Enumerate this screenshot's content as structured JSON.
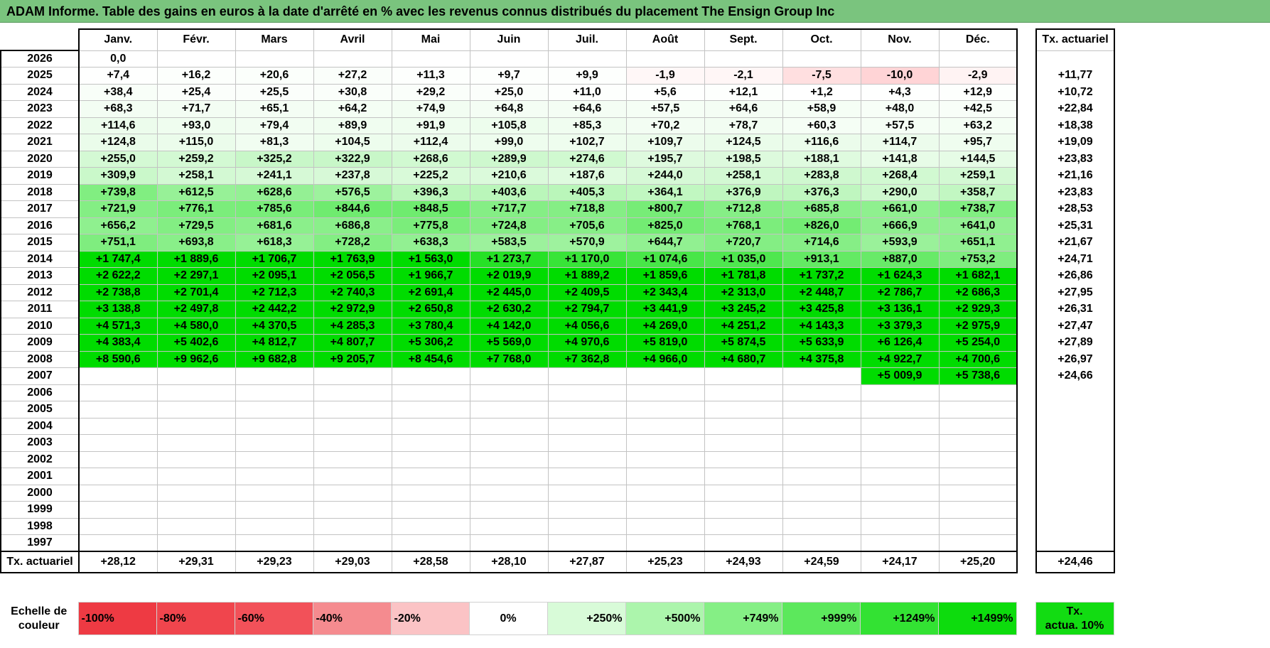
{
  "title": "ADAM Informe. Table des gains en euros à la date d'arrêté en % avec les revenus connus distribués du placement The Ensign Group Inc",
  "months": [
    "Janv.",
    "Févr.",
    "Mars",
    "Avril",
    "Mai",
    "Juin",
    "Juil.",
    "Août",
    "Sept.",
    "Oct.",
    "Nov.",
    "Déc."
  ],
  "actuarial_header": "Tx. actuariel",
  "rows": [
    {
      "year": "2026",
      "values": [
        "0,0",
        "",
        "",
        "",
        "",
        "",
        "",
        "",
        "",
        "",
        "",
        ""
      ],
      "rate": ""
    },
    {
      "year": "2025",
      "values": [
        "+7,4",
        "+16,2",
        "+20,6",
        "+27,2",
        "+11,3",
        "+9,7",
        "+9,9",
        "-1,9",
        "-2,1",
        "-7,5",
        "-10,0",
        "-2,9"
      ],
      "rate": "+11,77"
    },
    {
      "year": "2024",
      "values": [
        "+38,4",
        "+25,4",
        "+25,5",
        "+30,8",
        "+29,2",
        "+25,0",
        "+11,0",
        "+5,6",
        "+12,1",
        "+1,2",
        "+4,3",
        "+12,9"
      ],
      "rate": "+10,72"
    },
    {
      "year": "2023",
      "values": [
        "+68,3",
        "+71,7",
        "+65,1",
        "+64,2",
        "+74,9",
        "+64,8",
        "+64,6",
        "+57,5",
        "+64,6",
        "+58,9",
        "+48,0",
        "+42,5"
      ],
      "rate": "+22,84"
    },
    {
      "year": "2022",
      "values": [
        "+114,6",
        "+93,0",
        "+79,4",
        "+89,9",
        "+91,9",
        "+105,8",
        "+85,3",
        "+70,2",
        "+78,7",
        "+60,3",
        "+57,5",
        "+63,2"
      ],
      "rate": "+18,38"
    },
    {
      "year": "2021",
      "values": [
        "+124,8",
        "+115,0",
        "+81,3",
        "+104,5",
        "+112,4",
        "+99,0",
        "+102,7",
        "+109,7",
        "+124,5",
        "+116,6",
        "+114,7",
        "+95,7"
      ],
      "rate": "+19,09"
    },
    {
      "year": "2020",
      "values": [
        "+255,0",
        "+259,2",
        "+325,2",
        "+322,9",
        "+268,6",
        "+289,9",
        "+274,6",
        "+195,7",
        "+198,5",
        "+188,1",
        "+141,8",
        "+144,5"
      ],
      "rate": "+23,83"
    },
    {
      "year": "2019",
      "values": [
        "+309,9",
        "+258,1",
        "+241,1",
        "+237,8",
        "+225,2",
        "+210,6",
        "+187,6",
        "+244,0",
        "+258,1",
        "+283,8",
        "+268,4",
        "+259,1"
      ],
      "rate": "+21,16"
    },
    {
      "year": "2018",
      "values": [
        "+739,8",
        "+612,5",
        "+628,6",
        "+576,5",
        "+396,3",
        "+403,6",
        "+405,3",
        "+364,1",
        "+376,9",
        "+376,3",
        "+290,0",
        "+358,7"
      ],
      "rate": "+23,83"
    },
    {
      "year": "2017",
      "values": [
        "+721,9",
        "+776,1",
        "+785,6",
        "+844,6",
        "+848,5",
        "+717,7",
        "+718,8",
        "+800,7",
        "+712,8",
        "+685,8",
        "+661,0",
        "+738,7"
      ],
      "rate": "+28,53"
    },
    {
      "year": "2016",
      "values": [
        "+656,2",
        "+729,5",
        "+681,6",
        "+686,8",
        "+775,8",
        "+724,8",
        "+705,6",
        "+825,0",
        "+768,1",
        "+826,0",
        "+666,9",
        "+641,0"
      ],
      "rate": "+25,31"
    },
    {
      "year": "2015",
      "values": [
        "+751,1",
        "+693,8",
        "+618,3",
        "+728,2",
        "+638,3",
        "+583,5",
        "+570,9",
        "+644,7",
        "+720,7",
        "+714,6",
        "+593,9",
        "+651,1"
      ],
      "rate": "+21,67"
    },
    {
      "year": "2014",
      "values": [
        "+1 747,4",
        "+1 889,6",
        "+1 706,7",
        "+1 763,9",
        "+1 563,0",
        "+1 273,7",
        "+1 170,0",
        "+1 074,6",
        "+1 035,0",
        "+913,1",
        "+887,0",
        "+753,2"
      ],
      "rate": "+24,71"
    },
    {
      "year": "2013",
      "values": [
        "+2 622,2",
        "+2 297,1",
        "+2 095,1",
        "+2 056,5",
        "+1 966,7",
        "+2 019,9",
        "+1 889,2",
        "+1 859,6",
        "+1 781,8",
        "+1 737,2",
        "+1 624,3",
        "+1 682,1"
      ],
      "rate": "+26,86"
    },
    {
      "year": "2012",
      "values": [
        "+2 738,8",
        "+2 701,4",
        "+2 712,3",
        "+2 740,3",
        "+2 691,4",
        "+2 445,0",
        "+2 409,5",
        "+2 343,4",
        "+2 313,0",
        "+2 448,7",
        "+2 786,7",
        "+2 686,3"
      ],
      "rate": "+27,95"
    },
    {
      "year": "2011",
      "values": [
        "+3 138,8",
        "+2 497,8",
        "+2 442,2",
        "+2 972,9",
        "+2 650,8",
        "+2 630,2",
        "+2 794,7",
        "+3 441,9",
        "+3 245,2",
        "+3 425,8",
        "+3 136,1",
        "+2 929,3"
      ],
      "rate": "+26,31"
    },
    {
      "year": "2010",
      "values": [
        "+4 571,3",
        "+4 580,0",
        "+4 370,5",
        "+4 285,3",
        "+3 780,4",
        "+4 142,0",
        "+4 056,6",
        "+4 269,0",
        "+4 251,2",
        "+4 143,3",
        "+3 379,3",
        "+2 975,9"
      ],
      "rate": "+27,47"
    },
    {
      "year": "2009",
      "values": [
        "+4 383,4",
        "+5 402,6",
        "+4 812,7",
        "+4 807,7",
        "+5 306,2",
        "+5 569,0",
        "+4 970,6",
        "+5 819,0",
        "+5 874,5",
        "+5 633,9",
        "+6 126,4",
        "+5 254,0"
      ],
      "rate": "+27,89"
    },
    {
      "year": "2008",
      "values": [
        "+8 590,6",
        "+9 962,6",
        "+9 682,8",
        "+9 205,7",
        "+8 454,6",
        "+7 768,0",
        "+7 362,8",
        "+4 966,0",
        "+4 680,7",
        "+4 375,8",
        "+4 922,7",
        "+4 700,6"
      ],
      "rate": "+26,97"
    },
    {
      "year": "2007",
      "values": [
        "",
        "",
        "",
        "",
        "",
        "",
        "",
        "",
        "",
        "",
        "+5 009,9",
        "+5 738,6"
      ],
      "rate": "+24,66"
    },
    {
      "year": "2006",
      "values": [
        "",
        "",
        "",
        "",
        "",
        "",
        "",
        "",
        "",
        "",
        "",
        ""
      ],
      "rate": ""
    },
    {
      "year": "2005",
      "values": [
        "",
        "",
        "",
        "",
        "",
        "",
        "",
        "",
        "",
        "",
        "",
        ""
      ],
      "rate": ""
    },
    {
      "year": "2004",
      "values": [
        "",
        "",
        "",
        "",
        "",
        "",
        "",
        "",
        "",
        "",
        "",
        ""
      ],
      "rate": ""
    },
    {
      "year": "2003",
      "values": [
        "",
        "",
        "",
        "",
        "",
        "",
        "",
        "",
        "",
        "",
        "",
        ""
      ],
      "rate": ""
    },
    {
      "year": "2002",
      "values": [
        "",
        "",
        "",
        "",
        "",
        "",
        "",
        "",
        "",
        "",
        "",
        ""
      ],
      "rate": ""
    },
    {
      "year": "2001",
      "values": [
        "",
        "",
        "",
        "",
        "",
        "",
        "",
        "",
        "",
        "",
        "",
        ""
      ],
      "rate": ""
    },
    {
      "year": "2000",
      "values": [
        "",
        "",
        "",
        "",
        "",
        "",
        "",
        "",
        "",
        "",
        "",
        ""
      ],
      "rate": ""
    },
    {
      "year": "1999",
      "values": [
        "",
        "",
        "",
        "",
        "",
        "",
        "",
        "",
        "",
        "",
        "",
        ""
      ],
      "rate": ""
    },
    {
      "year": "1998",
      "values": [
        "",
        "",
        "",
        "",
        "",
        "",
        "",
        "",
        "",
        "",
        "",
        ""
      ],
      "rate": ""
    },
    {
      "year": "1997",
      "values": [
        "",
        "",
        "",
        "",
        "",
        "",
        "",
        "",
        "",
        "",
        "",
        ""
      ],
      "rate": ""
    }
  ],
  "footer": {
    "label": "Tx. actuariel",
    "values": [
      "+28,12",
      "+29,31",
      "+29,23",
      "+29,03",
      "+28,58",
      "+28,10",
      "+27,87",
      "+25,23",
      "+24,93",
      "+24,59",
      "+24,17",
      "+25,20"
    ],
    "rate": "+24,46"
  },
  "scale": {
    "label_line1": "Echelle de",
    "label_line2": "couleur",
    "swatches": [
      {
        "text": "-100%",
        "color": "#ee3a43",
        "align": "left"
      },
      {
        "text": "-80%",
        "color": "#f0454d",
        "align": "left"
      },
      {
        "text": "-60%",
        "color": "#f25159",
        "align": "left"
      },
      {
        "text": "-40%",
        "color": "#f58b8f",
        "align": "left"
      },
      {
        "text": "-20%",
        "color": "#fbc3c5",
        "align": "left"
      },
      {
        "text": "0%",
        "color": "#ffffff",
        "align": "center"
      },
      {
        "text": "+250%",
        "color": "#d8fbd8",
        "align": "right"
      },
      {
        "text": "+500%",
        "color": "#acf5ac",
        "align": "right"
      },
      {
        "text": "+749%",
        "color": "#85ef85",
        "align": "right"
      },
      {
        "text": "+999%",
        "color": "#5ce85c",
        "align": "right"
      },
      {
        "text": "+1249%",
        "color": "#33e233",
        "align": "right"
      },
      {
        "text": "+1499%",
        "color": "#0ddc0d",
        "align": "right"
      }
    ],
    "rate_line1": "Tx.",
    "rate_line2": "actua. 10%",
    "rate_color": "#12dc12"
  },
  "colors": {
    "title_bg": "#7ac47e",
    "positive": "#00dc00",
    "negative": "#ff3c46"
  }
}
